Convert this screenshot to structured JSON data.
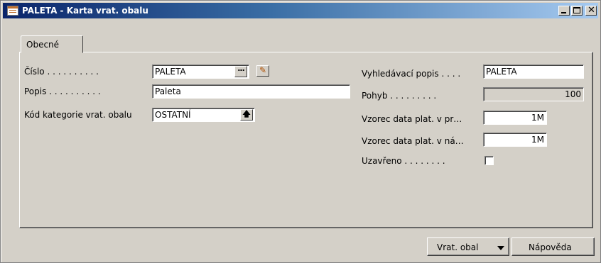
{
  "window": {
    "title": "PALETA - Karta vrat. obalu",
    "icon": "card-form-icon"
  },
  "tabs": [
    {
      "label": "Obecné",
      "active": true
    }
  ],
  "left": {
    "cislo_label": "Číslo . . . . . . . . . .",
    "cislo_value": "PALETA",
    "popis_label": "Popis . . . . . . . . . .",
    "popis_value": "Paleta",
    "kod_label": "Kód kategorie vrat. obalu",
    "kod_value": "OSTATNÍ"
  },
  "right": {
    "vyhl_label": "Vyhledávací popis . . . .",
    "vyhl_value": "PALETA",
    "pohyb_label": "Pohyb . . . . . . . . .",
    "pohyb_value": "100",
    "vzorec1_label": "Vzorec data plat. v pr…",
    "vzorec1_value": "1M",
    "vzorec2_label": "Vzorec data plat. v ná…",
    "vzorec2_value": "1M",
    "uzavreno_label": "Uzavřeno . . . . . . . .",
    "uzavreno_checked": false
  },
  "buttons": {
    "vrat_obal": "Vrat. obal",
    "napoveda": "Nápověda"
  },
  "colors": {
    "title_start": "#0a246a",
    "title_end": "#a6caf0",
    "face": "#d4d0c8"
  }
}
